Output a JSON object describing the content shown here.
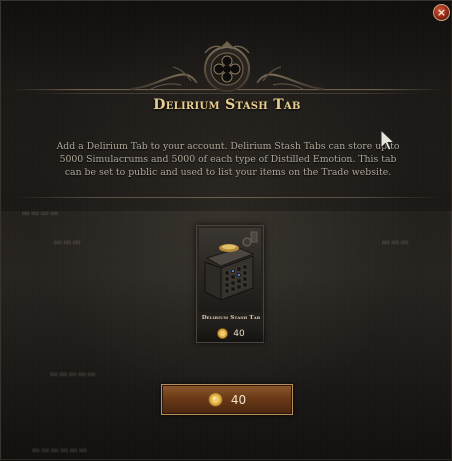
{
  "dialog": {
    "title": "Delirium Stash Tab",
    "description": "Add a Delirium Tab to your account. Delirium Stash Tabs can store up to 5000 Simulacrums and 5000 of each type of Distilled Emotion. This tab can be set to public and used to list your items on the Trade website.",
    "close_icon": "close-icon",
    "close_label": "×"
  },
  "item": {
    "name": "Delirium Stash Tab",
    "price": "40",
    "currency_icon": "point-coin-icon"
  },
  "purchase": {
    "price": "40",
    "currency_icon": "point-coin-icon"
  },
  "colors": {
    "title_gold": "#e9cf8e",
    "button_bronze": "#6a3a17",
    "close_red": "#8a2414",
    "coin_gold": "#d9a640"
  }
}
